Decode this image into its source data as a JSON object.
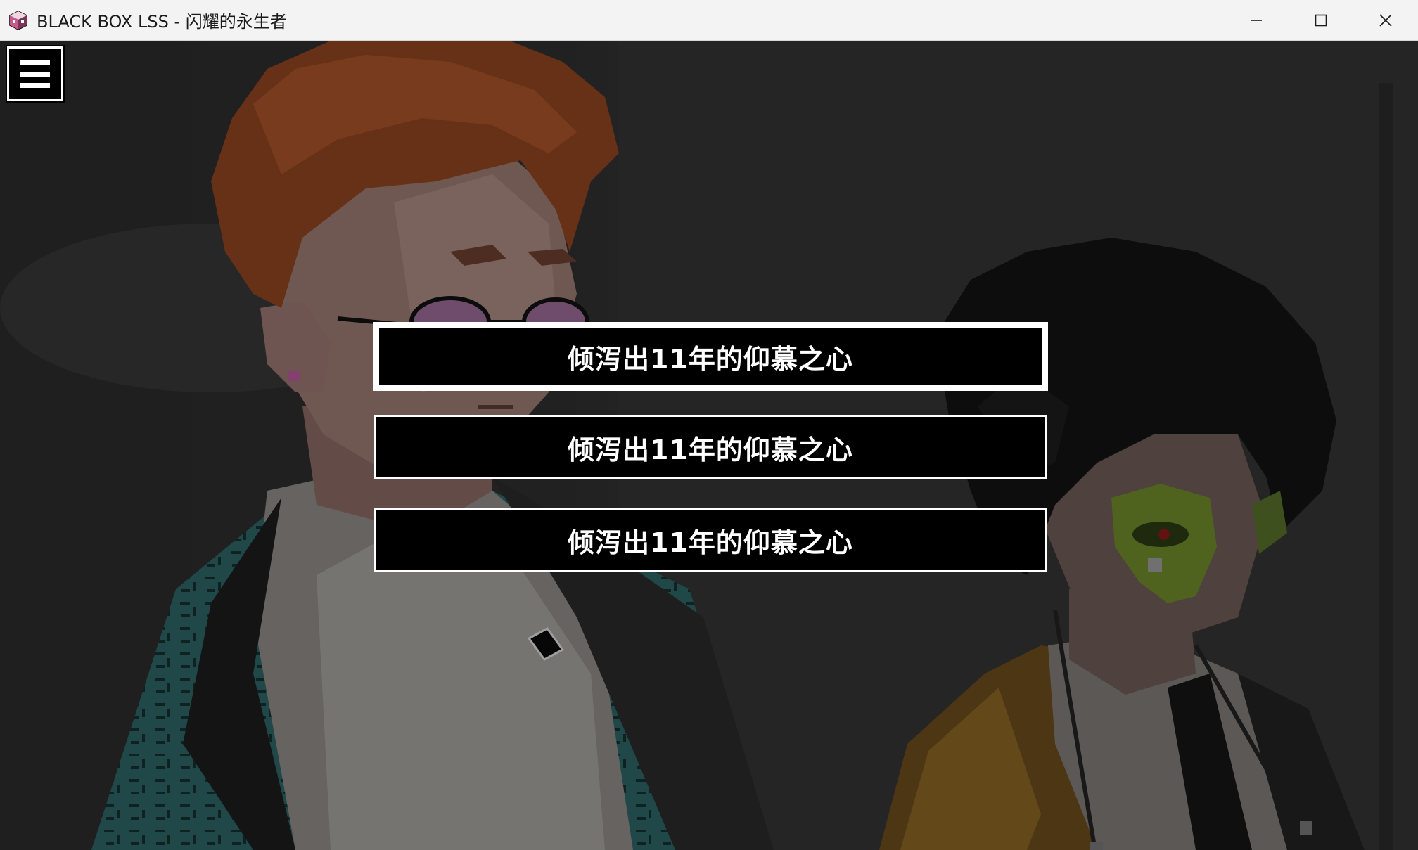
{
  "window": {
    "title": "BLACK BOX LSS - 闪耀的永生者",
    "app_icon": "pixel-cube-icon",
    "controls": [
      "minimize-icon",
      "maximize-icon",
      "close-icon"
    ]
  },
  "menu": {
    "icon": "hamburger-menu-icon"
  },
  "choices": [
    {
      "label": "倾泻出11年的仰慕之心",
      "selected": true
    },
    {
      "label": "倾泻出11年的仰慕之心",
      "selected": false
    },
    {
      "label": "倾泻出11年的仰慕之心",
      "selected": false
    }
  ],
  "colors": {
    "hair_left": "#b5582b",
    "jacket_teal": "#2f6566",
    "mask_green": "#6e8a2c",
    "jacket_gold": "#b98932",
    "choice_bg": "#000000",
    "choice_border": "#ffffff"
  }
}
